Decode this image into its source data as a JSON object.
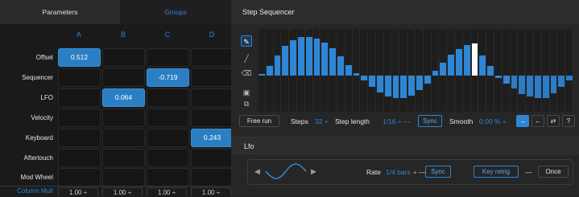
{
  "tabs": {
    "parameters": "Parameters",
    "groups": "Groups"
  },
  "columns": [
    "A",
    "B",
    "C",
    "D"
  ],
  "rows": [
    {
      "label": "Offset",
      "cells": [
        "0.512",
        "",
        "",
        ""
      ]
    },
    {
      "label": "Sequencer",
      "cells": [
        "",
        "",
        "-0.719",
        ""
      ]
    },
    {
      "label": "LFO",
      "cells": [
        "",
        "0.064",
        "",
        ""
      ]
    },
    {
      "label": "Velocity",
      "cells": [
        "",
        "",
        "",
        ""
      ]
    },
    {
      "label": "Keyboard",
      "cells": [
        "",
        "",
        "",
        "0.243"
      ]
    },
    {
      "label": "Aftertouch",
      "cells": [
        "",
        "",
        "",
        ""
      ]
    },
    {
      "label": "Mod Wheel",
      "cells": [
        "",
        "",
        "",
        ""
      ]
    }
  ],
  "column_mult": {
    "label": "Column Mult",
    "values": [
      "1.00 ÷",
      "1.00 ÷",
      "1.00 ÷",
      "1.00 ÷"
    ]
  },
  "step_sequencer": {
    "title": "Step Sequencer",
    "tools": [
      "pencil-icon",
      "line-icon",
      "eraser-icon",
      "randomize-icon",
      "paste-icon"
    ],
    "steps": [
      0.05,
      0.25,
      0.52,
      0.78,
      0.92,
      1.0,
      1.0,
      0.96,
      0.86,
      0.7,
      0.5,
      0.28,
      0.06,
      -0.14,
      -0.36,
      -0.52,
      -0.64,
      -0.7,
      -0.7,
      -0.62,
      -0.46,
      -0.26,
      0.12,
      0.34,
      0.54,
      0.68,
      0.8,
      0.84,
      0.52,
      0.26,
      -0.08,
      -0.24,
      -0.4,
      -0.58,
      -0.66,
      -0.7,
      -0.7,
      -0.56,
      -0.34,
      -0.14
    ],
    "current_step": 27,
    "active_steps": 32,
    "free_run": "Free run",
    "steps_label": "Steps",
    "steps_value": "32 ÷",
    "step_length_label": "Step length",
    "step_length_value": "1/16 ÷ —",
    "sync": "Sync",
    "smooth_label": "Smooth",
    "smooth_value": "0.00 % ÷",
    "play_buttons": [
      "→",
      "←",
      "⇄",
      "?"
    ]
  },
  "lfo": {
    "title": "Lfo",
    "rate_label": "Rate",
    "rate_value": "1/4 bars",
    "rate_suffix": "÷ —",
    "sync": "Sync",
    "key_retrig": "Key retrig",
    "dash": "—",
    "once": "Once"
  },
  "colors": {
    "accent": "#2e86d6",
    "active_cell": "#2a7fc4",
    "current_step": "#ffffff"
  }
}
